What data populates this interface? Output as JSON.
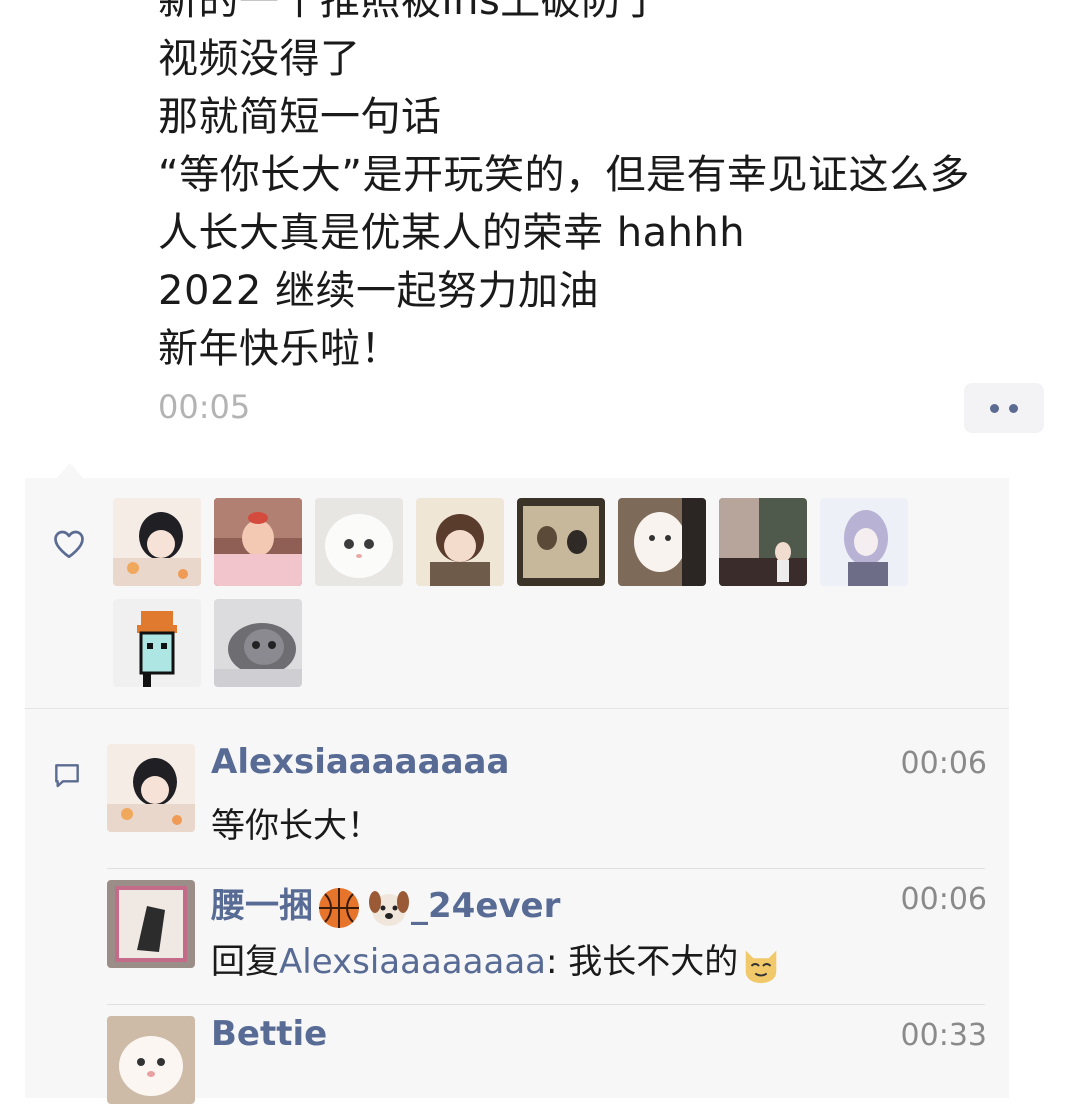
{
  "post": {
    "lines": [
      "新的一个推照被ins上破防了",
      "视频没得了",
      "那就简短一句话",
      "“等你长大”是开玩笑的，但是有幸见证这么多",
      "人长大真是优某人的荣幸 hahhh",
      "2022 继续一起努力加油",
      "新年快乐啦！"
    ],
    "timestamp": "00:05"
  },
  "likes": {
    "icon": "heart-outline-icon",
    "avatar_count": 10
  },
  "comments": [
    {
      "name": "Alexsiaaaaaaaa",
      "time": "00:06",
      "text": "等你长大！",
      "avatar_color": "#f2d6c9"
    },
    {
      "name": "腰一捆",
      "name_suffix": "_24ever",
      "name_emojis": [
        "basketball",
        "dog-face"
      ],
      "time": "00:06",
      "reply_prefix": "回复",
      "reply_to": "Alexsiaaaaaaaa",
      "text": ": 我长不大的",
      "text_emoji": "cat-face",
      "avatar_color": "#8f7f7a"
    },
    {
      "name": "Bettie",
      "time": "00:33",
      "text": "",
      "avatar_color": "#efe7dd"
    }
  ],
  "colors": {
    "link": "#586b95",
    "panel": "#f7f7f7",
    "muted": "#b3b3b3"
  }
}
